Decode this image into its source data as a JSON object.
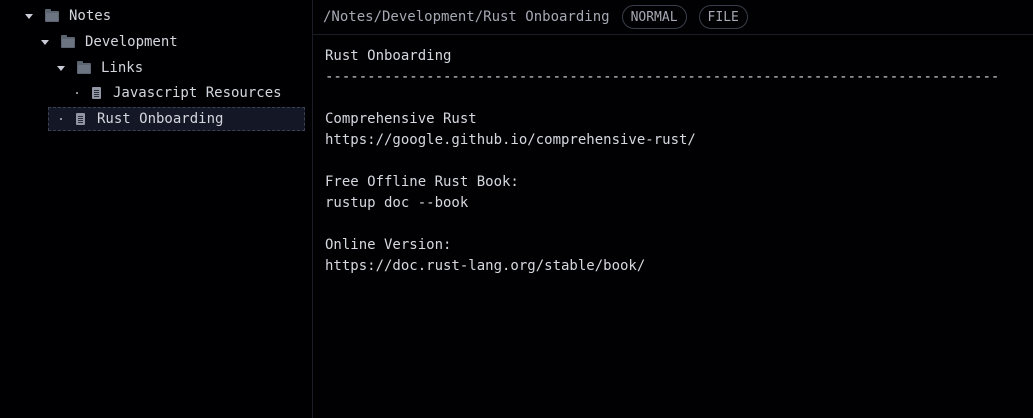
{
  "tree": {
    "items": [
      {
        "label": "Notes",
        "type": "folder",
        "expanded": true
      },
      {
        "label": "Development",
        "type": "folder",
        "expanded": true
      },
      {
        "label": "Links",
        "type": "folder",
        "expanded": true
      },
      {
        "label": "Javascript Resources",
        "type": "file"
      },
      {
        "label": "Rust Onboarding",
        "type": "file",
        "selected": true
      }
    ]
  },
  "header": {
    "path": "/Notes/Development/Rust Onboarding",
    "mode_badge": "NORMAL",
    "type_badge": "FILE"
  },
  "editor": {
    "lines": [
      "Rust Onboarding",
      "--------------------------------------------------------------------------------",
      "",
      "Comprehensive Rust",
      "https://google.github.io/comprehensive-rust/",
      "",
      "Free Offline Rust Book:",
      "rustup doc --book",
      "",
      "Online Version:",
      "https://doc.rust-lang.org/stable/book/"
    ]
  },
  "colors": {
    "background": "#010103",
    "selection": "#141826",
    "text": "#d6d8e0",
    "muted": "#a6a9b4"
  }
}
